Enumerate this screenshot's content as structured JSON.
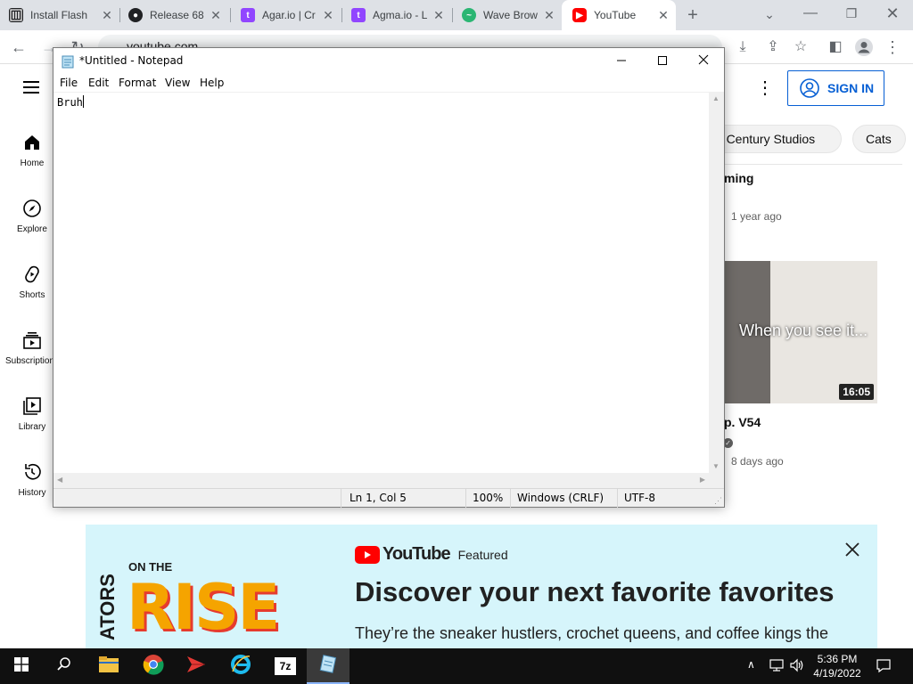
{
  "browser": {
    "tabs": [
      {
        "title": "Install Flash",
        "favicon": "library-icon",
        "active": false
      },
      {
        "title": "Release 68",
        "favicon": "github-icon",
        "active": false
      },
      {
        "title": "Agar.io | Cr",
        "favicon": "twitch-icon",
        "active": false
      },
      {
        "title": "Agma.io - L",
        "favicon": "twitch-icon",
        "active": false
      },
      {
        "title": "Wave Brow",
        "favicon": "wave-icon",
        "active": false
      },
      {
        "title": "YouTube",
        "favicon": "youtube-icon",
        "active": true
      }
    ],
    "address": "youtube.com",
    "colors": {
      "tabbar": "#dee1e6",
      "active_tab": "#ffffff"
    }
  },
  "youtube": {
    "sidebar": [
      {
        "label": "Home",
        "icon": "home-icon"
      },
      {
        "label": "Explore",
        "icon": "compass-icon"
      },
      {
        "label": "Shorts",
        "icon": "shorts-icon"
      },
      {
        "label": "Subscriptions",
        "icon": "subscriptions-icon"
      },
      {
        "label": "Library",
        "icon": "library-icon"
      },
      {
        "label": "History",
        "icon": "history-icon"
      }
    ],
    "signin_label": "SIGN IN",
    "chips": [
      "th Century Studios",
      "Cats"
    ],
    "video1": {
      "title_fragment": "ming",
      "meta": "1 year ago"
    },
    "video2": {
      "thumb_caption": "When you see it...",
      "duration": "16:05",
      "title_fragment": "p. V54",
      "meta": "8 days ago"
    },
    "banner": {
      "brand": "YouTube",
      "tag": "Featured",
      "headline": "Discover your next favorite favorites",
      "subtext": "They’re the sneaker hustlers, crochet queens, and coffee kings the",
      "art_small": "ON THE",
      "art_big": "RISE",
      "art_side": "ATORS"
    },
    "colors": {
      "accent": "#065fd4",
      "brand_red": "#ff0000",
      "banner_bg": "#d6f5fb"
    }
  },
  "notepad": {
    "title": "*Untitled - Notepad",
    "menu": [
      "File",
      "Edit",
      "Format",
      "View",
      "Help"
    ],
    "content": "Bruh",
    "status": {
      "position": "Ln 1, Col 5",
      "zoom": "100%",
      "line_ending": "Windows (CRLF)",
      "encoding": "UTF-8"
    }
  },
  "taskbar": {
    "apps": [
      "file-explorer-icon",
      "chrome-icon",
      "arrow-app-icon",
      "internet-explorer-icon",
      "7zip-icon",
      "notepad-icon"
    ],
    "time": "5:36 PM",
    "date": "4/19/2022"
  }
}
